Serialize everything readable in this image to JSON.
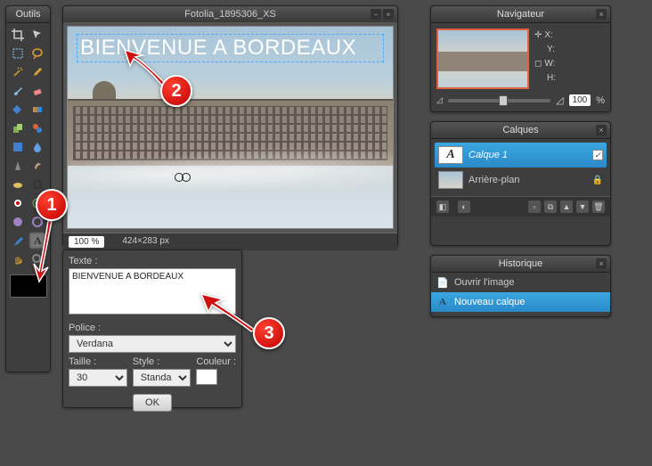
{
  "tools_panel": {
    "title": "Outils"
  },
  "canvas": {
    "title": "Fotolia_1895306_XS",
    "overlay_text": "BIENVENUE A BORDEAUX",
    "zoom": "100 %",
    "dimensions": "424×283 px"
  },
  "text_panel": {
    "texte_label": "Texte :",
    "texte_value": "BIENVENUE A BORDEAUX",
    "police_label": "Police :",
    "police_value": "Verdana",
    "taille_label": "Taille :",
    "taille_value": "30",
    "style_label": "Style :",
    "style_value": "Standard",
    "couleur_label": "Couleur :",
    "ok_label": "OK"
  },
  "navigator": {
    "title": "Navigateur",
    "x_label": "X:",
    "y_label": "Y:",
    "w_label": "W:",
    "h_label": "H:",
    "zoom": "100",
    "zoom_unit": "%"
  },
  "layers": {
    "title": "Calques",
    "items": [
      {
        "label": "Calque 1"
      },
      {
        "label": "Arrière-plan"
      }
    ]
  },
  "history": {
    "title": "Historique",
    "items": [
      {
        "label": "Ouvrir l'image"
      },
      {
        "label": "Nouveau calque"
      }
    ]
  },
  "callouts": {
    "c1": "1",
    "c2": "2",
    "c3": "3"
  }
}
